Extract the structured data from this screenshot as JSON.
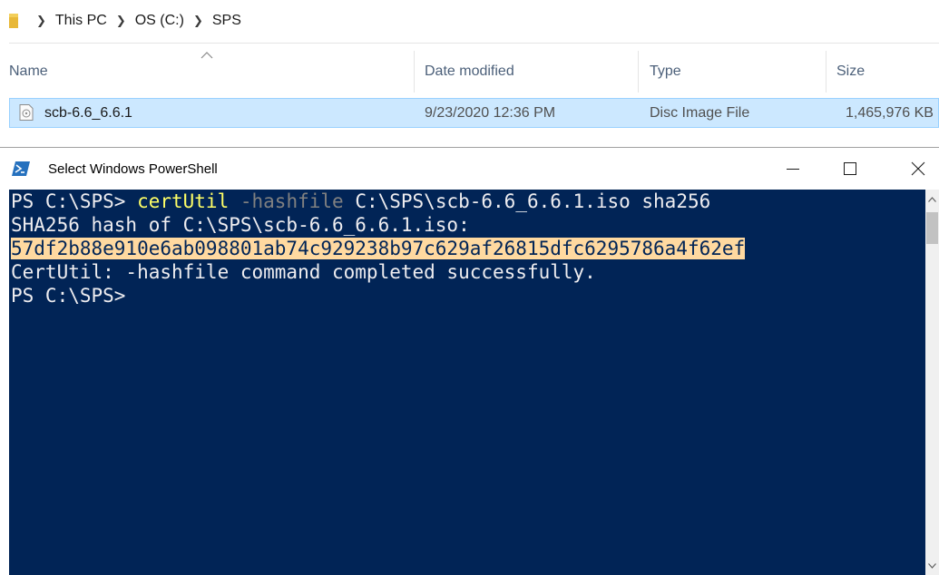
{
  "explorer": {
    "breadcrumb": [
      "This PC",
      "OS (C:)",
      "SPS"
    ],
    "columns": {
      "name": "Name",
      "date_modified": "Date modified",
      "type": "Type",
      "size": "Size"
    },
    "files": [
      {
        "name": "scb-6.6_6.6.1",
        "date_modified": "9/23/2020 12:36 PM",
        "type": "Disc Image File",
        "size": "1,465,976 KB",
        "icon": "disc-image-icon",
        "selected": true
      }
    ]
  },
  "powershell": {
    "title": "Select Windows PowerShell",
    "lines": {
      "prompt1": "PS C:\\SPS> ",
      "cmd": "certUtil",
      "param": " -hashfile",
      "args": " C:\\SPS\\scb-6.6_6.6.1.iso sha256",
      "hash_label": "SHA256 hash of C:\\SPS\\scb-6.6_6.6.1.iso:",
      "hash_value": "57df2b88e910e6ab098801ab74c929238b97c629af26815dfc6295786a4f62ef",
      "completed": "CertUtil: -hashfile command completed successfully.",
      "prompt2": "PS C:\\SPS>"
    }
  },
  "colors": {
    "console_bg": "#012456",
    "console_text": "#eeedf0",
    "command_yellow": "#ffff66",
    "parameter_gray": "#808080",
    "highlight": "#ffd9a0",
    "selection_bg": "#cce8ff"
  }
}
